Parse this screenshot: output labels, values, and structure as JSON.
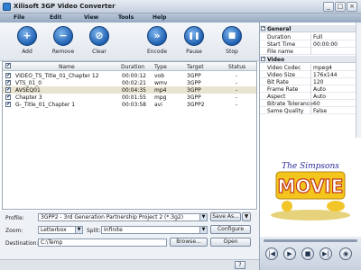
{
  "window": {
    "title": "Xilisoft 3GP Video Converter",
    "minimize": "_",
    "maximize": "□",
    "close": "×"
  },
  "menu": [
    "File",
    "Edit",
    "View",
    "Tools",
    "Help"
  ],
  "toolbar": [
    {
      "label": "Add",
      "glyph": "+"
    },
    {
      "label": "Remove",
      "glyph": "−"
    },
    {
      "label": "Clear",
      "glyph": "⊘"
    },
    {
      "label": "Encode",
      "glyph": "»"
    },
    {
      "label": "Pause",
      "glyph": "❚❚"
    },
    {
      "label": "Stop",
      "glyph": "■"
    }
  ],
  "list": {
    "headers": {
      "name": "Name",
      "duration": "Duration",
      "type": "Type",
      "target": "Target",
      "status": "Status"
    },
    "rows": [
      {
        "name": "VIDEO_TS_Title_01_Chapter 12",
        "duration": "00:00:12",
        "type": "vob",
        "target": "3GPP",
        "status": "-",
        "checked": true,
        "selected": false
      },
      {
        "name": "VTS_01_0",
        "duration": "00:02:21",
        "type": "wmv",
        "target": "3GPP",
        "status": "-",
        "checked": true,
        "selected": false
      },
      {
        "name": "AVSEQ01",
        "duration": "00:04:35",
        "type": "mp4",
        "target": "3GPP",
        "status": "-",
        "checked": true,
        "selected": true
      },
      {
        "name": "Chapter 3",
        "duration": "00:01:55",
        "type": "mpg",
        "target": "3GPP",
        "status": "-",
        "checked": true,
        "selected": false
      },
      {
        "name": "G-_Title_01_Chapter 1",
        "duration": "00:03:58",
        "type": "avi",
        "target": "3GPP2",
        "status": "-",
        "checked": true,
        "selected": false
      }
    ]
  },
  "bottom": {
    "profile_label": "Profile:",
    "profile_value": "3GPP2 - 3rd Generation Partnership Project 2  (*.3g2)",
    "save_as": "Save As...",
    "zoom_label": "Zoom:",
    "zoom_value": "Letterbox",
    "split_label": "Split:",
    "split_value": "Infinite",
    "configure": "Configure",
    "destination_label": "Destination:",
    "destination_value": "C:\\Temp",
    "browse": "Browse...",
    "open": "Open",
    "help": "?"
  },
  "properties": {
    "general_title": "General",
    "general": [
      {
        "key": "Duration",
        "value": "Full"
      },
      {
        "key": "Start Time",
        "value": "00:00:00"
      },
      {
        "key": "File name",
        "value": ""
      }
    ],
    "video_title": "Video",
    "video": [
      {
        "key": "Video Codec",
        "value": "mpeg4"
      },
      {
        "key": "Video Size",
        "value": "176x144"
      },
      {
        "key": "Bit Rate",
        "value": "120"
      },
      {
        "key": "Frame Rate",
        "value": "Auto"
      },
      {
        "key": "Aspect",
        "value": "Auto"
      },
      {
        "key": "Bitrate Tolerance",
        "value": "60"
      },
      {
        "key": "Same Quality",
        "value": "False"
      }
    ]
  },
  "preview": {
    "logo_top": "The Simpsons",
    "logo_main": "MOVIE"
  },
  "player": {
    "prev": "|◀",
    "play": "▶",
    "stop": "■",
    "next": "▶|",
    "snapshot": "◉"
  },
  "colors": {
    "accent": "#1e5fb0",
    "selection": "#e8e4d0"
  }
}
